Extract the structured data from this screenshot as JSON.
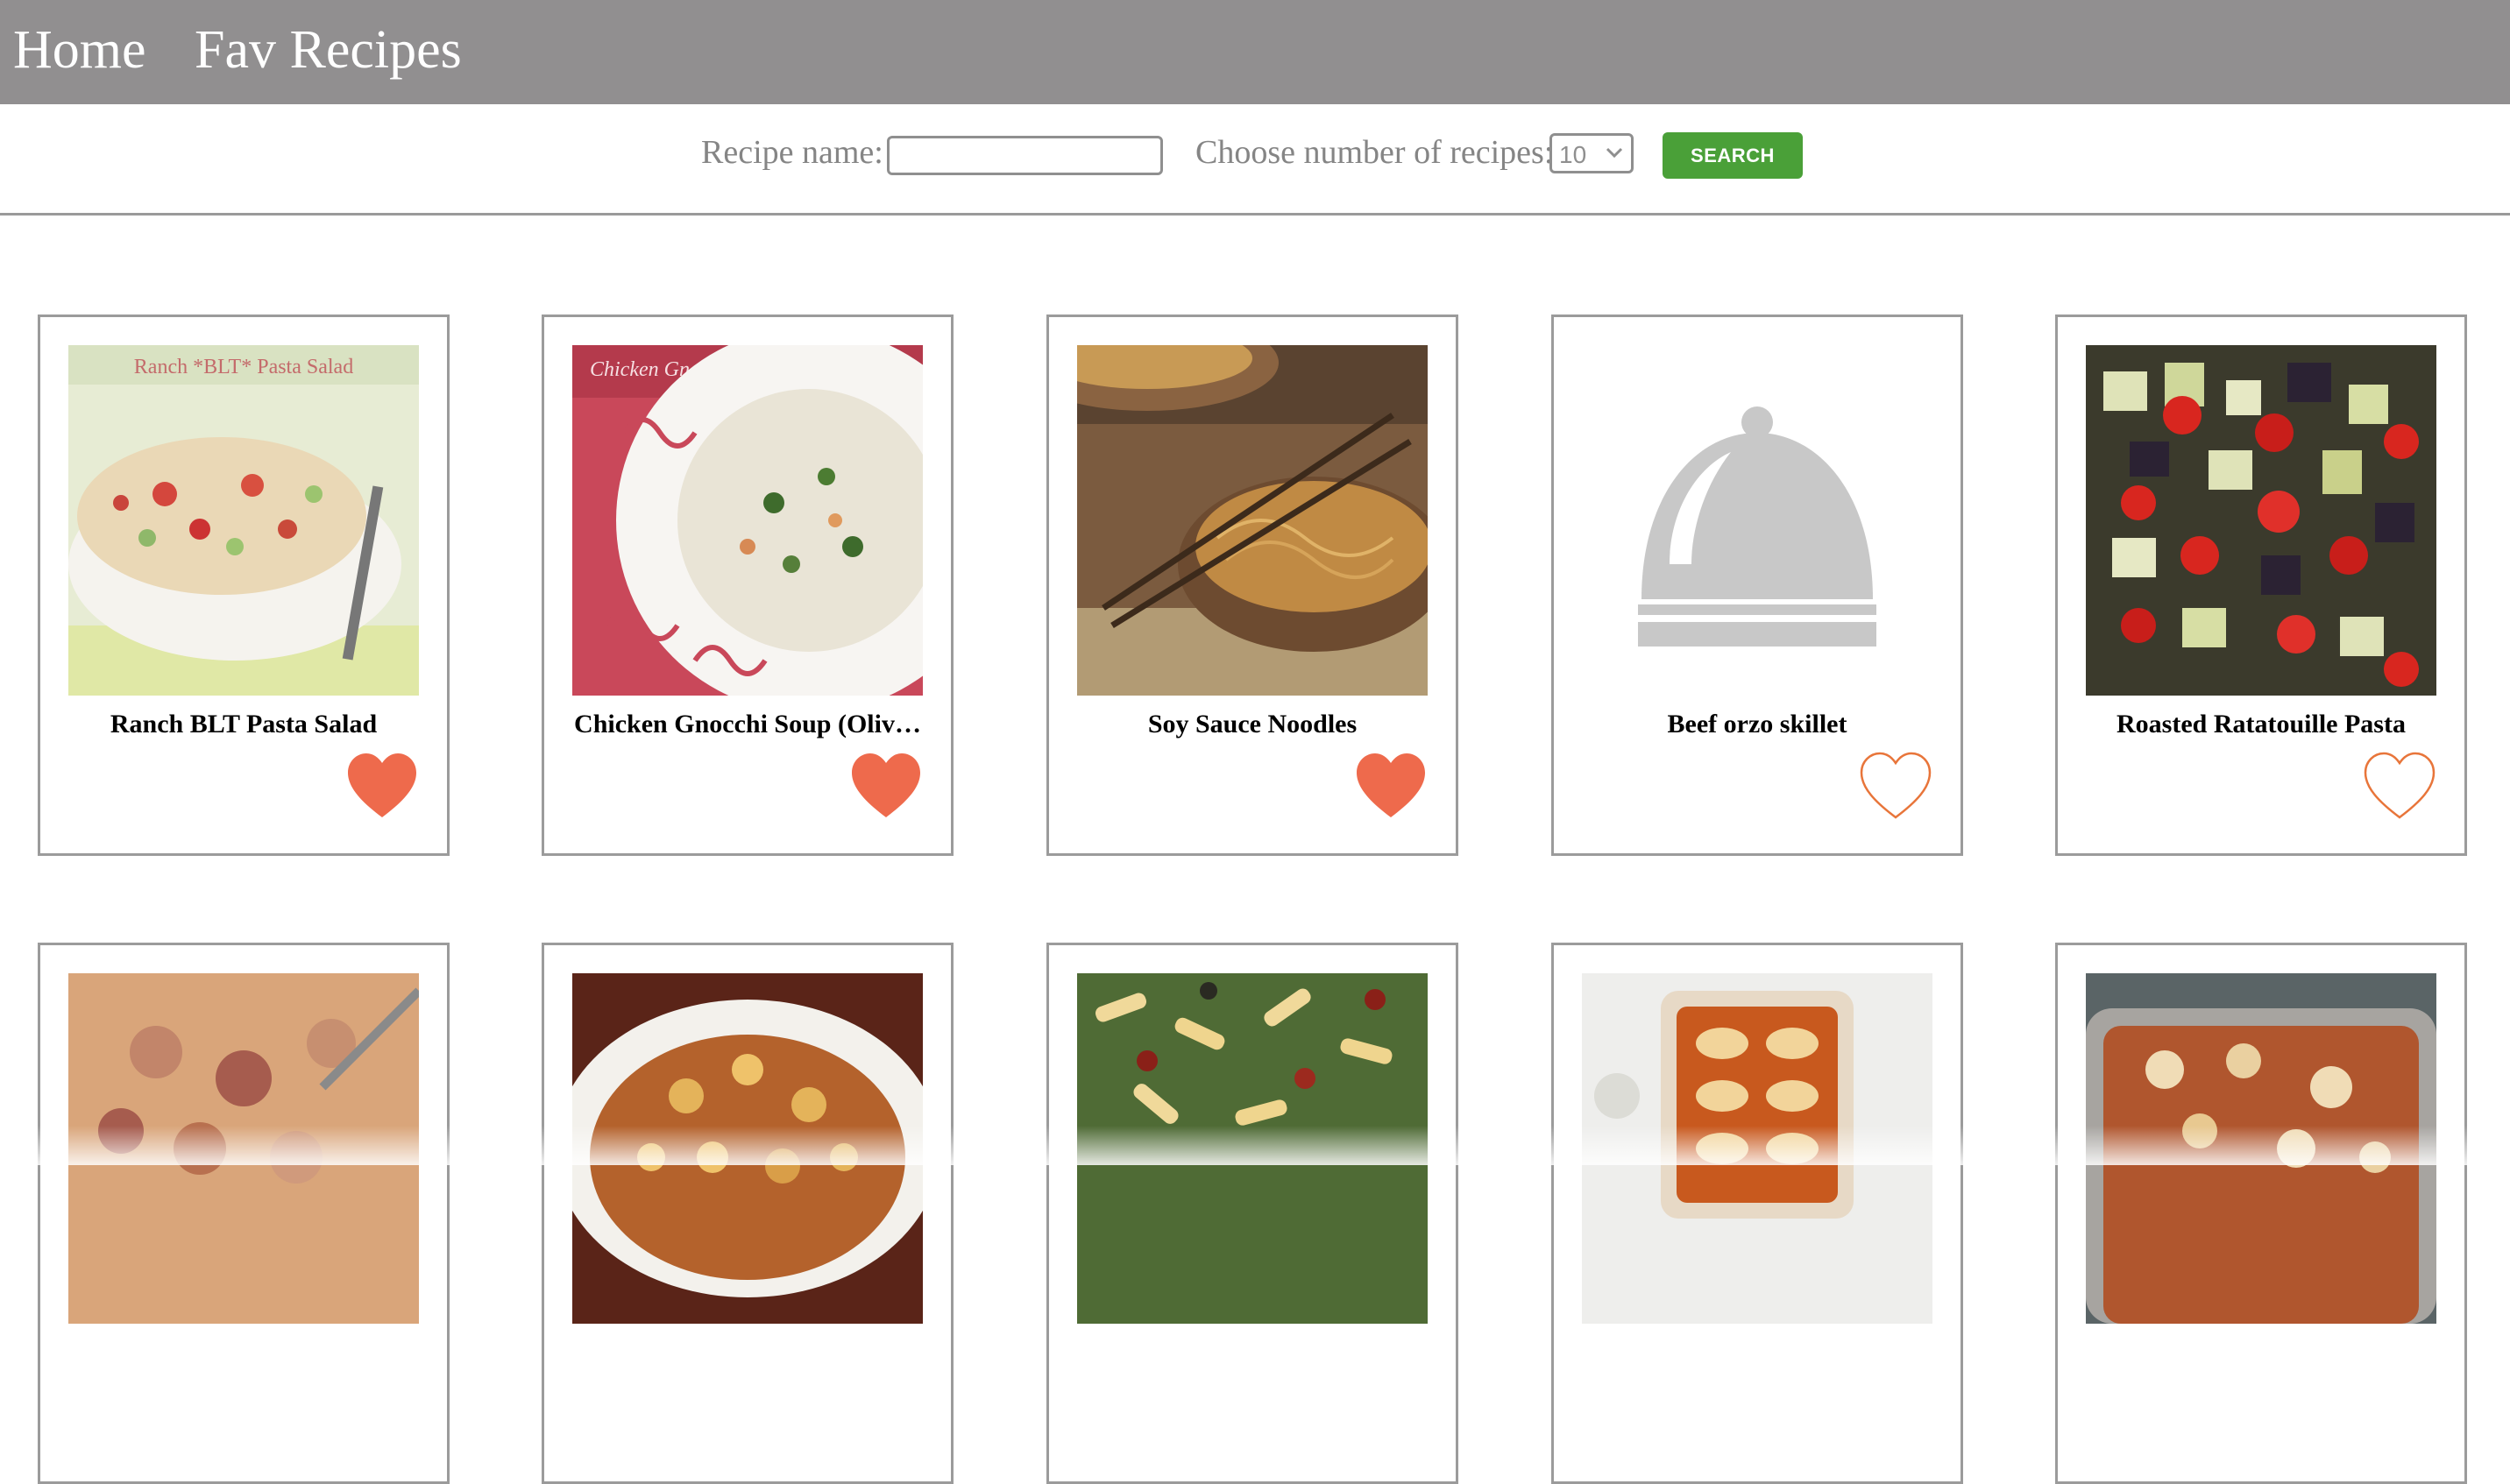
{
  "nav": {
    "home": "Home",
    "fav": "Fav Recipes"
  },
  "search": {
    "name_label": "Recipe name:",
    "name_value": "",
    "count_label": "Choose number of recipes:",
    "count_value": "10",
    "button": "SEARCH",
    "button_color": "#4aa038"
  },
  "colors": {
    "nav_bg": "#918f90",
    "heart": "#ee6a4c",
    "heart_outline": "#e8753a"
  },
  "recipes": [
    {
      "title": "Ranch BLT Pasta Salad",
      "favorite": true,
      "image_caption": "Ranch *BLT* Pasta Salad",
      "image_icon": "pasta-salad-photo"
    },
    {
      "title": "Chicken Gnocchi Soup (Oliv…",
      "favorite": true,
      "image_caption": "Chicken Gnocchi Soup",
      "image_icon": "soup-photo"
    },
    {
      "title": "Soy Sauce Noodles",
      "favorite": true,
      "image_icon": "noodles-photo"
    },
    {
      "title": "Beef orzo skillet",
      "favorite": false,
      "image_icon": "cloche-icon"
    },
    {
      "title": "Roasted Ratatouille Pasta",
      "favorite": false,
      "image_icon": "ratatouille-photo"
    },
    {
      "title": "",
      "image_icon": "macaroni-photo"
    },
    {
      "title": "",
      "image_icon": "gnocchi-bake-photo"
    },
    {
      "title": "",
      "image_icon": "penne-salad-photo"
    },
    {
      "title": "",
      "image_icon": "stuffed-shells-photo"
    },
    {
      "title": "",
      "image_icon": "baked-ziti-photo"
    }
  ]
}
